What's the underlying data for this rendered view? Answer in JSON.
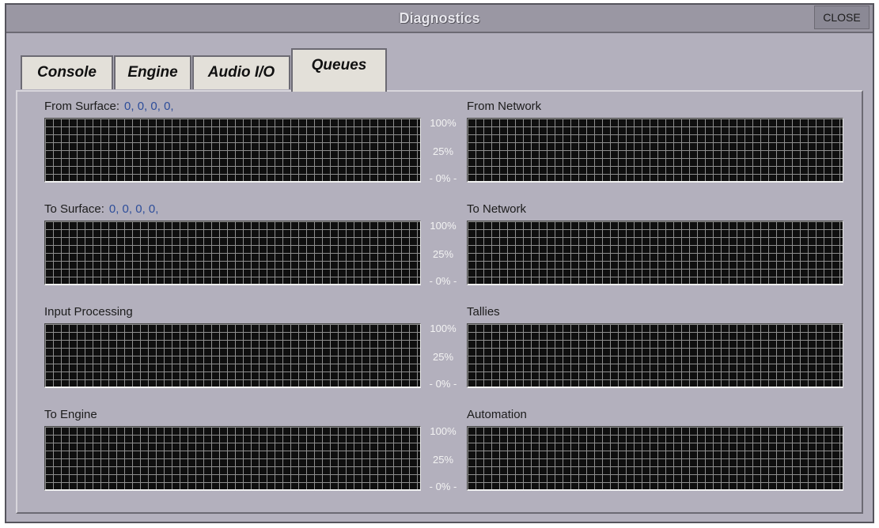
{
  "window": {
    "title": "Diagnostics",
    "close_label": "CLOSE"
  },
  "tabs": [
    {
      "label": "Console",
      "active": false
    },
    {
      "label": "Engine",
      "active": false
    },
    {
      "label": "Audio I/O",
      "active": false
    },
    {
      "label": "Queues",
      "active": true
    }
  ],
  "scale": {
    "top": "100%",
    "mid": "25%",
    "bottom": "- 0% -"
  },
  "rows": [
    {
      "left": {
        "label": "From Surface:",
        "values": "0, 0, 0, 0,"
      },
      "right": {
        "label": "From Network"
      }
    },
    {
      "left": {
        "label": "To Surface:",
        "values": "0, 0, 0, 0,"
      },
      "right": {
        "label": "To Network"
      }
    },
    {
      "left": {
        "label": "Input Processing"
      },
      "right": {
        "label": "Tallies"
      }
    },
    {
      "left": {
        "label": "To Engine"
      },
      "right": {
        "label": "Automation"
      }
    }
  ],
  "colors": {
    "window_bg": "#b3b0bd",
    "graph_bg": "#0f0f0f",
    "grid": "#8e8e8e",
    "value_text": "#2d4d9a"
  }
}
